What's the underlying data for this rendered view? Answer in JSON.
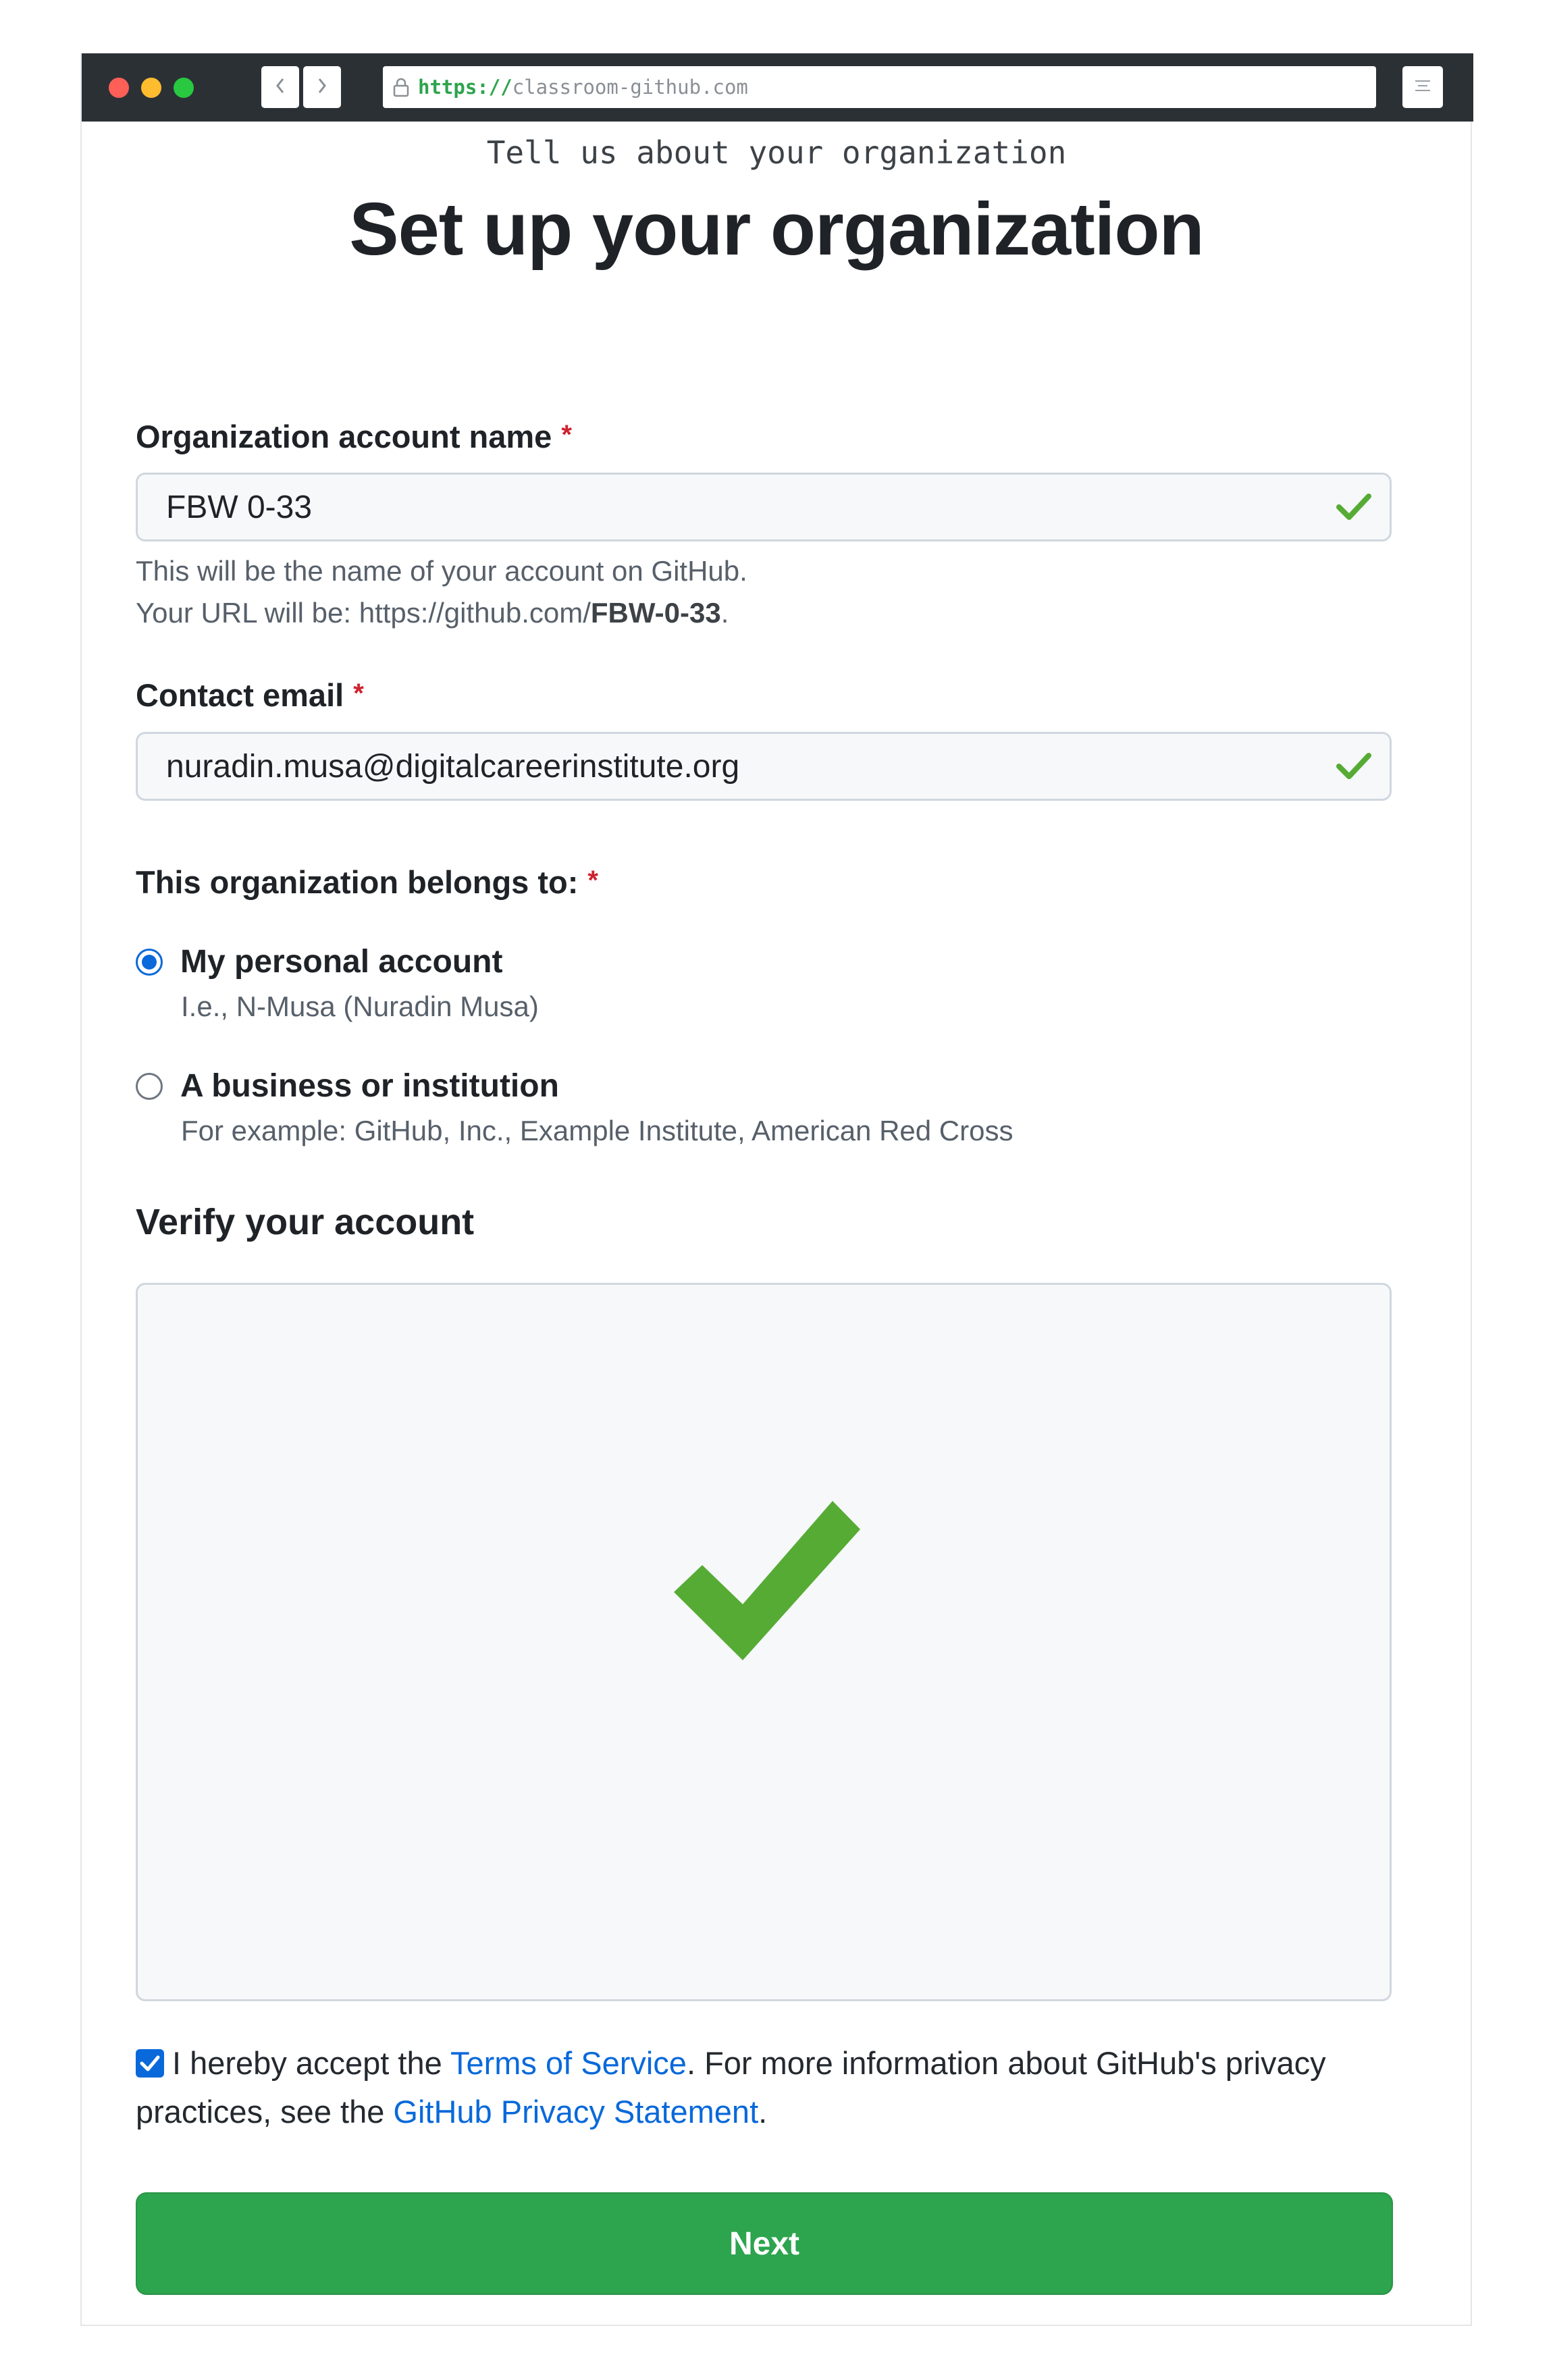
{
  "browser": {
    "url_scheme": "https://",
    "url_rest": "classroom-github.com",
    "traffic_colors": [
      "#fe5f57",
      "#febc2e",
      "#28c840"
    ],
    "icons": [
      "lock-icon",
      "back-chevron-icon",
      "forward-chevron-icon",
      "menu-lines-icon"
    ]
  },
  "page": {
    "subtitle": "Tell us about your organization",
    "title": "Set up your organization"
  },
  "form": {
    "org_name": {
      "label": "Organization account name",
      "required_mark": "*",
      "value": "FBW 0-33",
      "hint_line1": "This will be the name of your account on GitHub.",
      "hint_line2_prefix": "Your URL will be: https://github.com/",
      "hint_line2_slug": "FBW-0-33",
      "hint_line2_suffix": "."
    },
    "email": {
      "label": "Contact email",
      "required_mark": "*",
      "value": "nuradin.musa@digitalcareerinstitute.org"
    },
    "belongs_to": {
      "label": "This organization belongs to:",
      "required_mark": "*",
      "options": [
        {
          "label": "My personal account",
          "description": "I.e., N-Musa (Nuradin Musa)",
          "selected": true
        },
        {
          "label": "A business or institution",
          "description": "For example: GitHub, Inc., Example Institute, American Red Cross",
          "selected": false
        }
      ]
    },
    "verify": {
      "title": "Verify your account",
      "status": "verified"
    },
    "terms": {
      "checked": true,
      "text_before": "I hereby accept the ",
      "tos_link": "Terms of Service",
      "text_middle": ". For more information about GitHub's privacy practices, see the ",
      "privacy_link": "GitHub Privacy Statement",
      "text_after": "."
    },
    "submit_label": "Next"
  },
  "colors": {
    "accent_blue": "#0969da",
    "success_green": "#2da44e",
    "check_green": "#56ab34",
    "required_red": "#cf222e"
  }
}
